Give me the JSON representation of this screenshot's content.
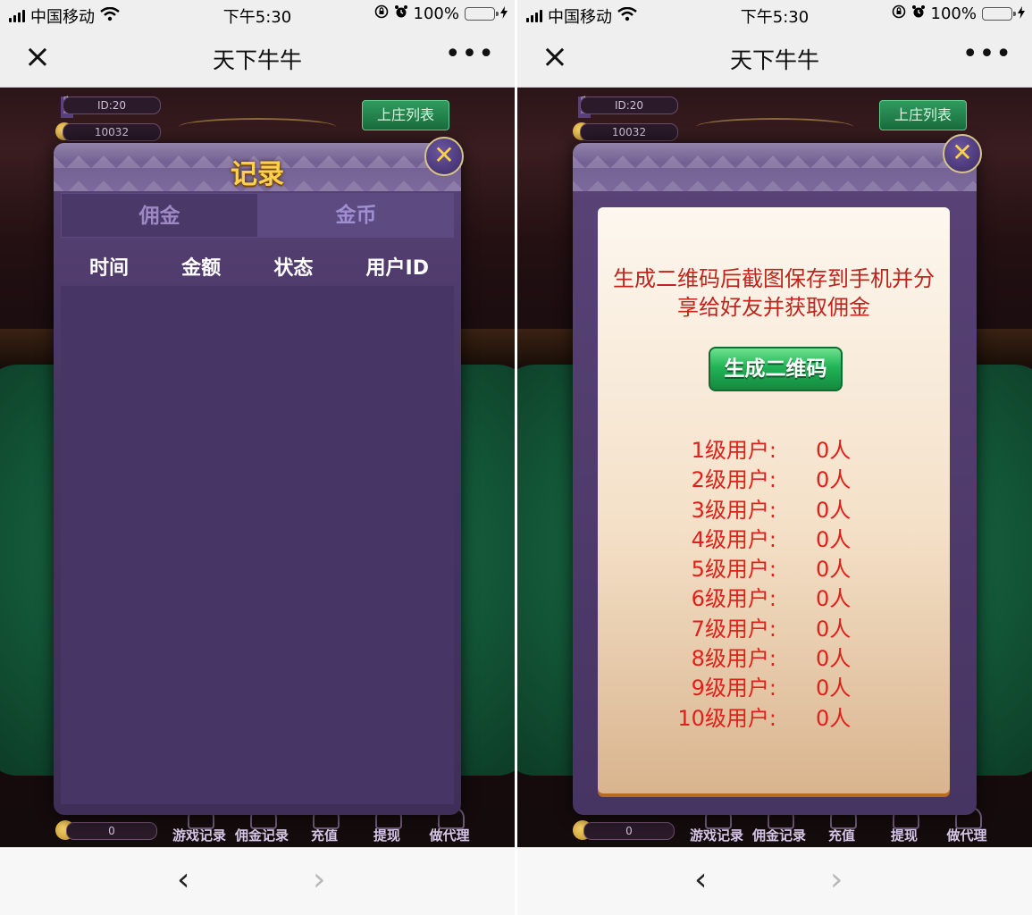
{
  "status_bar": {
    "carrier": "中国移动",
    "time": "下午5:30",
    "battery_percent": "100%",
    "battery_level": 1.0
  },
  "nav": {
    "close_icon": "×",
    "title": "天下牛牛",
    "more_icon": "•••"
  },
  "game": {
    "player_id": "ID:20",
    "player_coins": "10032",
    "banker_list_button": "上庄列表",
    "balance": "0",
    "bottom_menu": [
      {
        "label": "游戏记录",
        "icon": "game-record-icon"
      },
      {
        "label": "佣金记录",
        "icon": "commission-record-icon"
      },
      {
        "label": "充值",
        "icon": "recharge-icon"
      },
      {
        "label": "提现",
        "icon": "withdraw-icon"
      },
      {
        "label": "做代理",
        "icon": "agent-icon"
      }
    ]
  },
  "records_dialog": {
    "title": "记录",
    "close_icon": "✕",
    "tabs": [
      {
        "label": "佣金",
        "active": true
      },
      {
        "label": "金币",
        "active": false
      }
    ],
    "columns": [
      "时间",
      "金额",
      "状态",
      "用户ID"
    ]
  },
  "agent_dialog": {
    "close_icon": "✕",
    "message": "生成二维码后截图保存到手机并分享给好友并获取佣金",
    "generate_button": "生成二维码",
    "levels": [
      {
        "label": "1级用户:",
        "count": "0人"
      },
      {
        "label": "2级用户:",
        "count": "0人"
      },
      {
        "label": "3级用户:",
        "count": "0人"
      },
      {
        "label": "4级用户:",
        "count": "0人"
      },
      {
        "label": "5级用户:",
        "count": "0人"
      },
      {
        "label": "6级用户:",
        "count": "0人"
      },
      {
        "label": "7级用户:",
        "count": "0人"
      },
      {
        "label": "8级用户:",
        "count": "0人"
      },
      {
        "label": "9级用户:",
        "count": "0人"
      },
      {
        "label": "10级用户:",
        "count": "0人"
      }
    ]
  },
  "bottom_nav": {
    "back_icon": "‹",
    "forward_icon": "›"
  },
  "colors": {
    "accent_gold": "#ffd04a",
    "modal_purple": "#473565",
    "level_red": "#e0201a",
    "button_green": "#22b357"
  }
}
